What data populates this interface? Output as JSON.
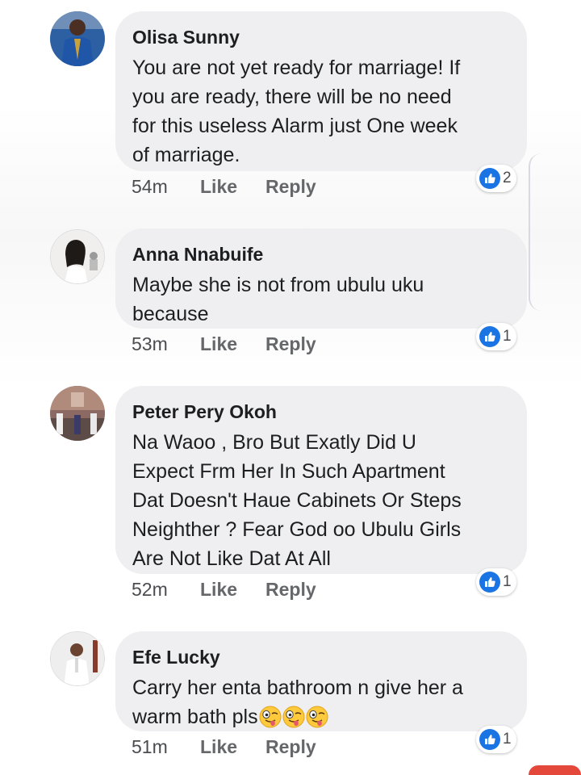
{
  "colors": {
    "bubble_bg": "#efeff1",
    "name_color": "#1c1e21",
    "meta_color": "#65676b",
    "like_blue": "#1b74e4"
  },
  "comments": [
    {
      "author": "Olisa Sunny",
      "lines": [
        "You are not yet ready for marriage! If",
        "you are ready, there will be no need",
        "for this useless Alarm just One week",
        "of marriage."
      ],
      "time": "54m",
      "like_label": "Like",
      "reply_label": "Reply",
      "reaction_icon": "thumbs-up-icon",
      "reaction_count": "2"
    },
    {
      "author": "Anna Nnabuife",
      "lines": [
        "Maybe she is not from ubulu uku",
        "because"
      ],
      "time": "53m",
      "like_label": "Like",
      "reply_label": "Reply",
      "reaction_icon": "thumbs-up-icon",
      "reaction_count": "1"
    },
    {
      "author": "Peter Pery Okoh",
      "lines": [
        "Na Waoo , Bro But Exatly Did U",
        "Expect Frm Her In Such Apartment",
        "Dat Doesn't Haue Cabinets Or Steps",
        "Neighther ? Fear God oo Ubulu Girls",
        "Are Not Like Dat At All"
      ],
      "time": "52m",
      "like_label": "Like",
      "reply_label": "Reply",
      "reaction_icon": "thumbs-up-icon",
      "reaction_count": "1"
    },
    {
      "author": "Efe Lucky",
      "lines": [
        "Carry her enta bathroom n give her a",
        "warm bath pls"
      ],
      "emoji": [
        "winking-tongue-emoji",
        "winking-tongue-emoji",
        "winking-tongue-emoji"
      ],
      "time": "51m",
      "like_label": "Like",
      "reply_label": "Reply",
      "reaction_icon": "thumbs-up-icon",
      "reaction_count": "1"
    }
  ]
}
